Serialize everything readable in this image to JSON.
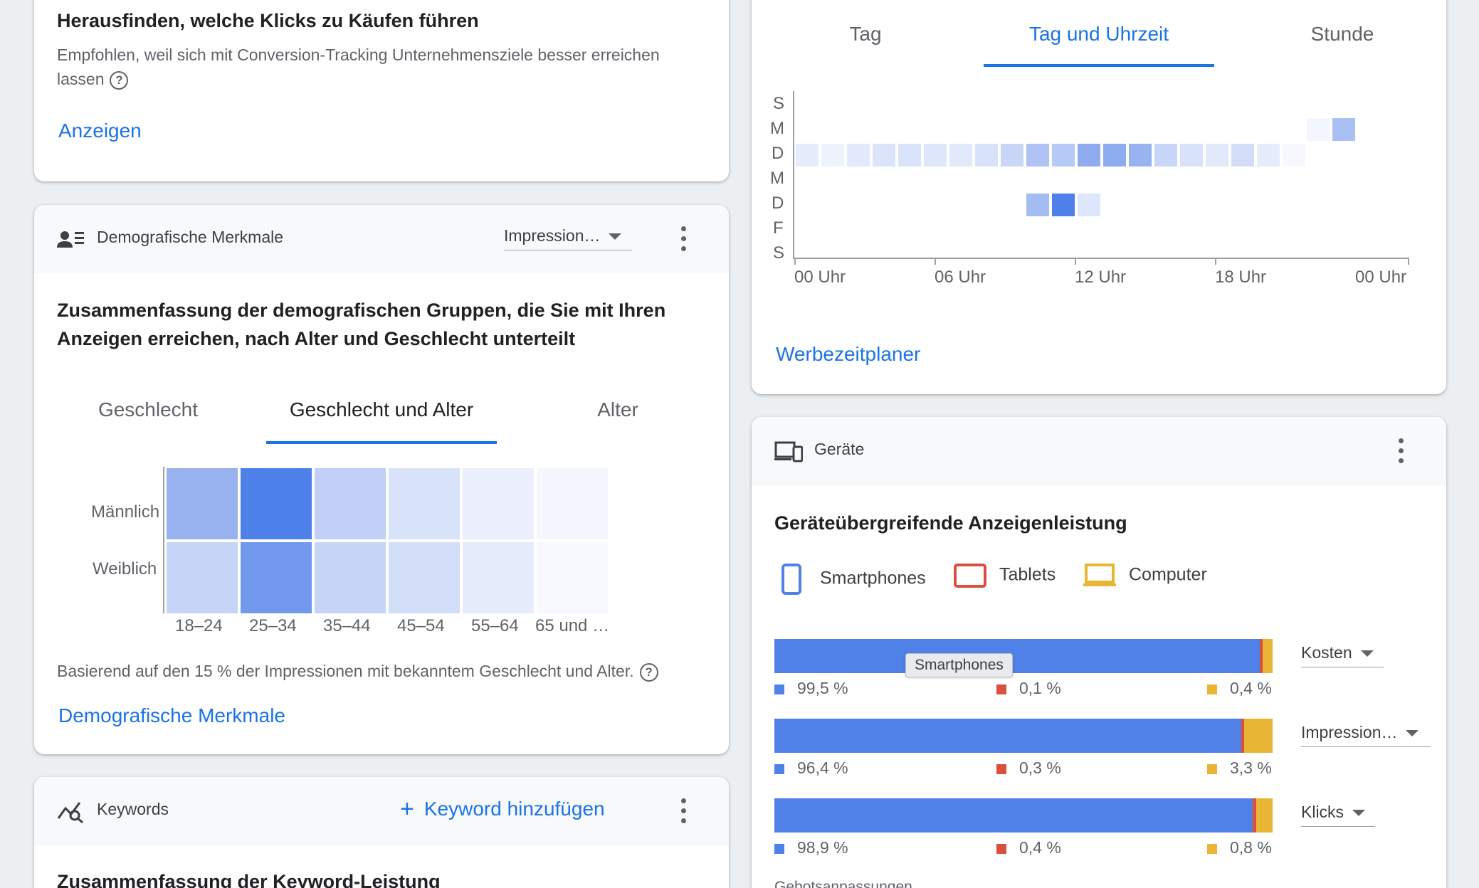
{
  "conversion_card": {
    "title": "Herausfinden, welche Klicks zu Käufen führen",
    "description": "Empfohlen, weil sich mit Conversion-Tracking Unternehmensziele besser erreichen lassen",
    "link": "Anzeigen"
  },
  "demographics_card": {
    "header": "Demografische Merkmale",
    "metric_dropdown": "Impression…",
    "heading": "Zusammenfassung der demografischen Gruppen, die Sie mit Ihren Anzeigen erreichen, nach Alter und Geschlecht unterteilt",
    "tabs": [
      "Geschlecht",
      "Geschlecht und Alter",
      "Alter"
    ],
    "active_tab": "Geschlecht und Alter",
    "heatmap": {
      "rows": [
        "Männlich",
        "Weiblich"
      ],
      "columns": [
        "18–24",
        "25–34",
        "35–44",
        "45–54",
        "55–64",
        "65 und …"
      ]
    },
    "note": "Basierend auf den 15 % der Impressionen mit bekanntem Geschlecht und Alter.",
    "link": "Demografische Merkmale"
  },
  "keywords_card": {
    "header": "Keywords",
    "add_button": "Keyword hinzufügen",
    "heading": "Zusammenfassung der Keyword-Leistung"
  },
  "schedule_card": {
    "tabs": [
      "Tag",
      "Tag und Uhrzeit",
      "Stunde"
    ],
    "active_tab": "Tag und Uhrzeit",
    "y_labels": [
      "S",
      "M",
      "D",
      "M",
      "D",
      "F",
      "S"
    ],
    "x_labels": [
      "00 Uhr",
      "06 Uhr",
      "12 Uhr",
      "18 Uhr",
      "00 Uhr"
    ],
    "link": "Werbezeitplaner"
  },
  "devices_card": {
    "header": "Geräte",
    "heading": "Geräteübergreifende Anzeigenleistung",
    "legend": [
      "Smartphones",
      "Tablets",
      "Computer"
    ],
    "tooltip": "Smartphones",
    "colors": {
      "smartphones": "#4f81e8",
      "tablets": "#d9503f",
      "computer": "#e8b634"
    },
    "rows": [
      {
        "metric": "Kosten",
        "smartphones": "99,5 %",
        "tablets": "0,1 %",
        "computer": "0,4 %"
      },
      {
        "metric": "Impression…",
        "smartphones": "96,4 %",
        "tablets": "0,3 %",
        "computer": "3,3 %"
      },
      {
        "metric": "Klicks",
        "smartphones": "98,9 %",
        "tablets": "0,4 %",
        "computer": "0,8 %"
      }
    ],
    "footer_partial": "Gebotsanpassungen"
  }
}
